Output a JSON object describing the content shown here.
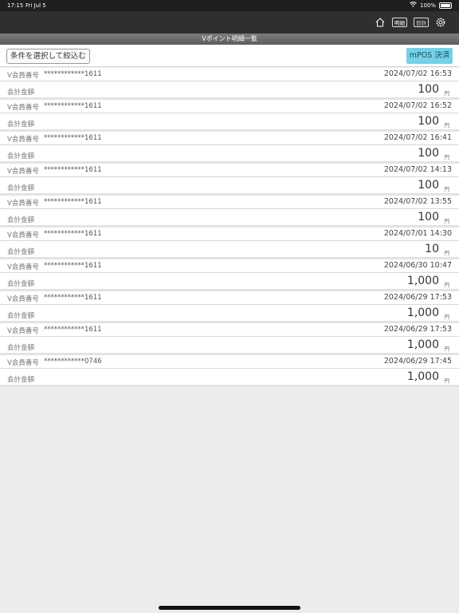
{
  "status": {
    "time": "17:15",
    "date": "Fri Jul 5",
    "battery": "100%",
    "battery_level": 1.0
  },
  "toolbar": {
    "meisai_label": "明細",
    "nikkei_label": "日計"
  },
  "page": {
    "title": "Vポイント明細一覧"
  },
  "filter": {
    "button_label": "条件を選択して絞込む",
    "mpos_label": "mPOS 決済"
  },
  "labels": {
    "member_no": "V会員番号",
    "amount": "会計金額",
    "yen": "円"
  },
  "transactions": [
    {
      "member": "************1611",
      "datetime": "2024/07/02 16:53",
      "amount": "100"
    },
    {
      "member": "************1611",
      "datetime": "2024/07/02 16:52",
      "amount": "100"
    },
    {
      "member": "************1611",
      "datetime": "2024/07/02 16:41",
      "amount": "100"
    },
    {
      "member": "************1611",
      "datetime": "2024/07/02 14:13",
      "amount": "100"
    },
    {
      "member": "************1611",
      "datetime": "2024/07/02 13:55",
      "amount": "100"
    },
    {
      "member": "************1611",
      "datetime": "2024/07/01 14:30",
      "amount": "10"
    },
    {
      "member": "************1611",
      "datetime": "2024/06/30 10:47",
      "amount": "1,000"
    },
    {
      "member": "************1611",
      "datetime": "2024/06/29 17:53",
      "amount": "1,000"
    },
    {
      "member": "************1611",
      "datetime": "2024/06/29 17:53",
      "amount": "1,000"
    },
    {
      "member": "************0746",
      "datetime": "2024/06/29 17:45",
      "amount": "1,000"
    }
  ],
  "colors": {
    "mpos_button": "#74d1e6",
    "appbar": "#2f2f2f"
  }
}
